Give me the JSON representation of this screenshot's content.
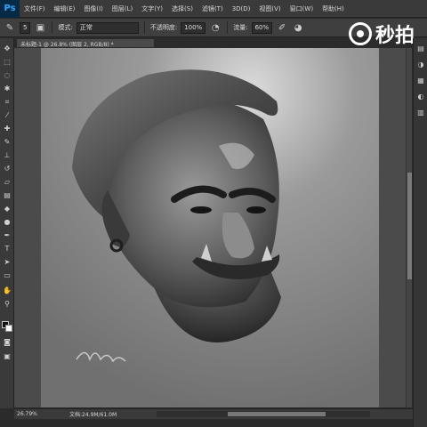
{
  "app": {
    "logo_text": "Ps"
  },
  "menu": [
    "文件(F)",
    "编辑(E)",
    "图像(I)",
    "图层(L)",
    "文字(Y)",
    "选择(S)",
    "滤镜(T)",
    "3D(D)",
    "视图(V)",
    "窗口(W)",
    "帮助(H)"
  ],
  "watermark": {
    "text": "秒拍"
  },
  "options": {
    "brush_size": "5",
    "mode_label": "模式:",
    "mode_value": "正常",
    "opacity_label": "不透明度:",
    "opacity_value": "100%",
    "flow_label": "流量:",
    "flow_value": "60%"
  },
  "document": {
    "tab_title": "未标题-1 @ 26.8% (图层 2, RGB/8) *"
  },
  "status": {
    "zoom": "26.79%",
    "doc_size": "文档:24.9M/61.0M"
  },
  "colors": {
    "foreground": "#111111",
    "background": "#ffffff",
    "ui_dark": "#3a3a3a"
  },
  "icons": {
    "toolbar": [
      "move-icon",
      "marquee-icon",
      "lasso-icon",
      "quick-select-icon",
      "crop-icon",
      "eyedropper-icon",
      "healing-icon",
      "brush-icon",
      "stamp-icon",
      "history-brush-icon",
      "eraser-icon",
      "gradient-icon",
      "blur-icon",
      "dodge-icon",
      "pen-icon",
      "type-icon",
      "path-select-icon",
      "shape-icon",
      "hand-icon",
      "zoom-icon"
    ]
  }
}
